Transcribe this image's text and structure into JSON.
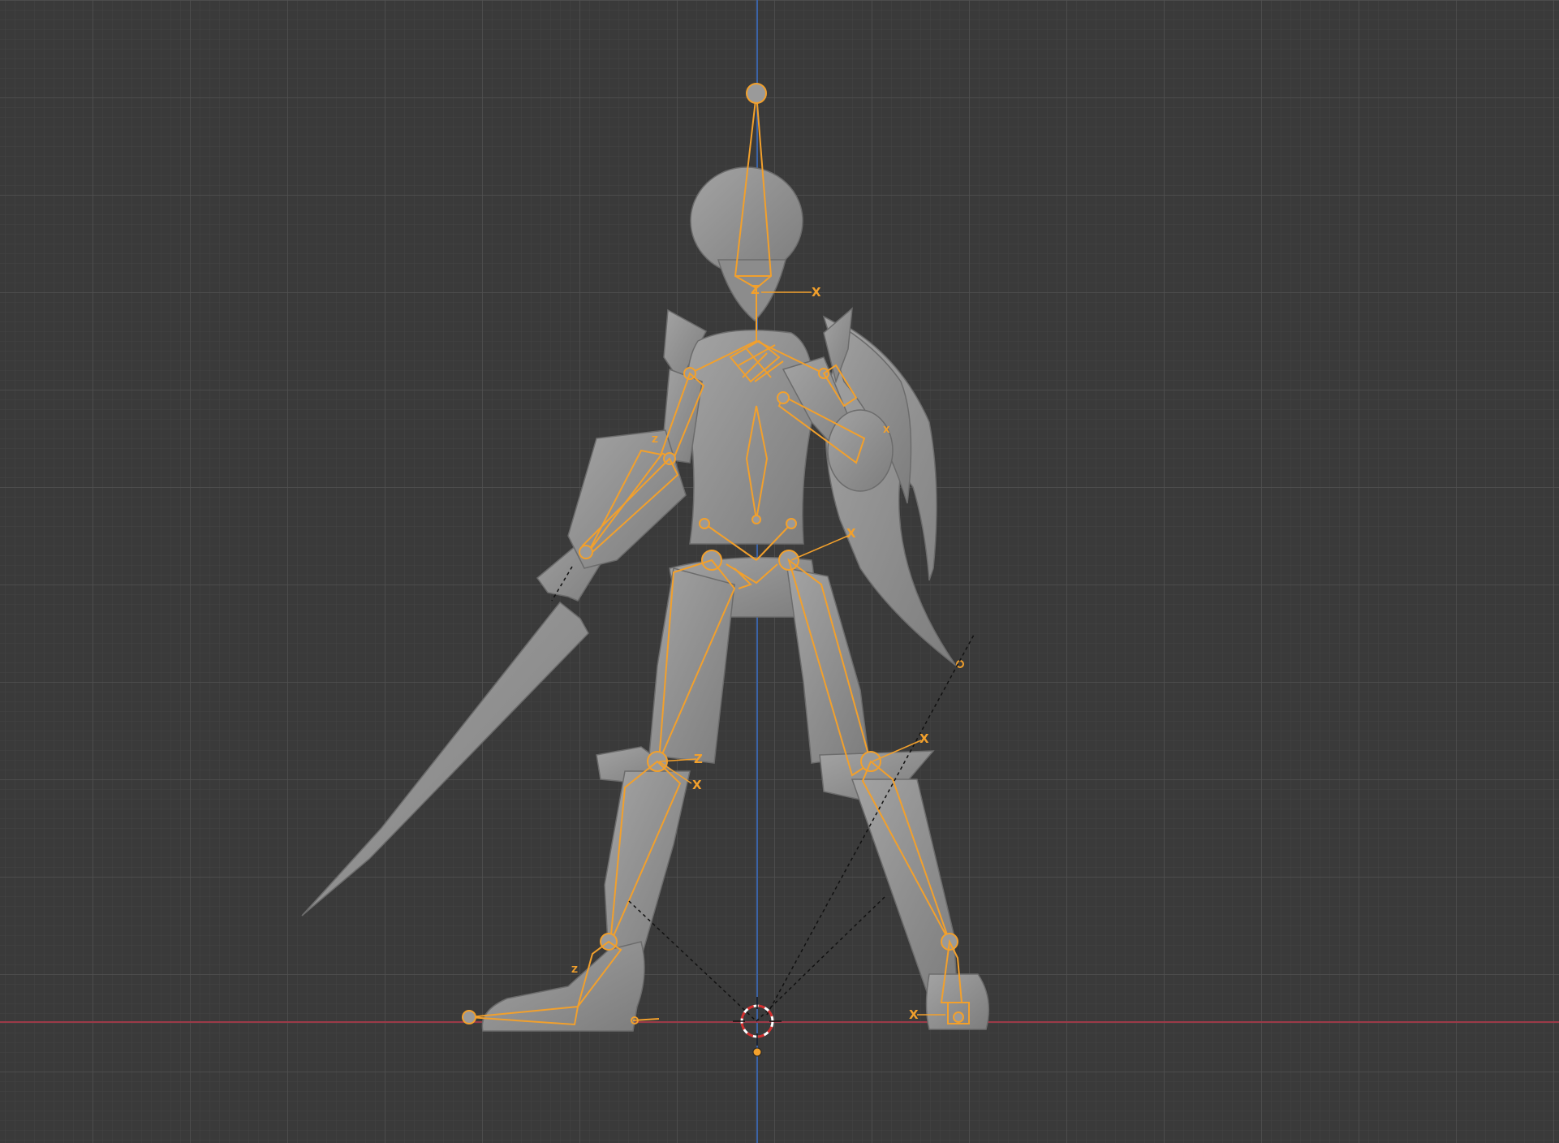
{
  "viewport": {
    "background": "#3a3a3a",
    "grid_minor": "#444444",
    "grid_major": "#4f4f4f",
    "x_axis_color": "#9c3a48",
    "z_axis_color": "#3b63a6"
  },
  "model": {
    "body_color": "#8e8e8e",
    "armature_color": "#f2a02c"
  },
  "axis_labels": {
    "x": "X",
    "z": "Z"
  },
  "cursor": {
    "name": "3d-cursor"
  }
}
